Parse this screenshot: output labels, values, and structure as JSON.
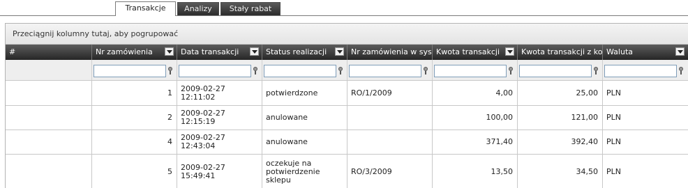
{
  "tabs": [
    {
      "label": "Transakcje",
      "active": true
    },
    {
      "label": "Analizy",
      "active": false
    },
    {
      "label": "Stały rabat",
      "active": false
    }
  ],
  "grid": {
    "group_hint": "Przeciągnij kolumny tutaj, aby pogrupować",
    "columns": [
      {
        "label": "#",
        "menu": false
      },
      {
        "label": "Nr zamówienia",
        "menu": true
      },
      {
        "label": "Data transakcji",
        "menu": true
      },
      {
        "label": "Status realizacji",
        "menu": true
      },
      {
        "label": "Nr zamówienia w systemie",
        "menu": false
      },
      {
        "label": "Kwota transakcji",
        "menu": true
      },
      {
        "label": "Kwota transakcji z ko",
        "menu": false
      },
      {
        "label": "Waluta",
        "menu": true
      }
    ],
    "rows": [
      {
        "nr": "1",
        "date": "2009-02-27\n12:11:02",
        "status": "potwierdzone",
        "sys": "RO/1/2009",
        "amount": "4,00",
        "amount_total": "25,00",
        "currency": "PLN"
      },
      {
        "nr": "2",
        "date": "2009-02-27\n12:15:19",
        "status": "anulowane",
        "sys": "",
        "amount": "100,00",
        "amount_total": "121,00",
        "currency": "PLN"
      },
      {
        "nr": "4",
        "date": "2009-02-27\n12:43:04",
        "status": "anulowane",
        "sys": "",
        "amount": "371,40",
        "amount_total": "392,40",
        "currency": "PLN"
      },
      {
        "nr": "5",
        "date": "2009-02-27\n15:49:41",
        "status": "oczekuje na\npotwierdzenie\nsklepu",
        "sys": "RO/3/2009",
        "amount": "13,50",
        "amount_total": "34,50",
        "currency": "PLN"
      }
    ]
  }
}
